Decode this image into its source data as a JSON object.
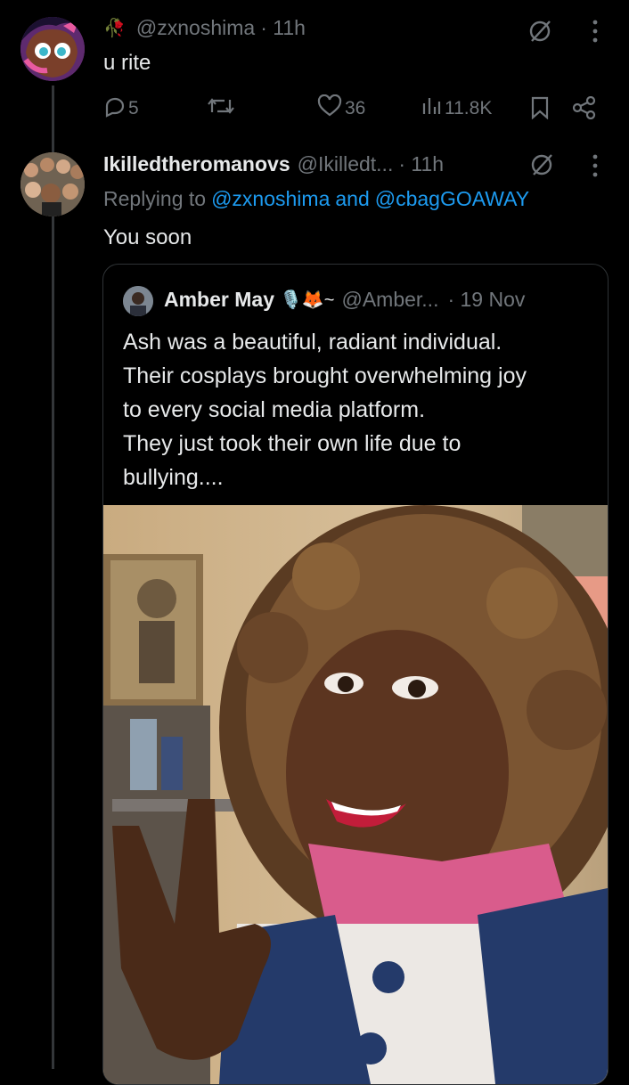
{
  "tweet1": {
    "rose_emoji": "🥀",
    "handle": "@zxnoshima",
    "time": "· 11h",
    "text": "u rite",
    "replies": "5",
    "likes": "36",
    "views": "11.8K"
  },
  "tweet2": {
    "display_name": "Ikilledtheromanovs",
    "handle": "@Ikilledt...",
    "time": "· 11h",
    "replying_prefix": "Replying to",
    "replying_user1": "@zxnoshima",
    "replying_and": "and",
    "replying_user2": "@cbagGOAWAY",
    "text": "You soon"
  },
  "quote": {
    "display_name": "Amber May",
    "emojis": "🎙️🦊~",
    "handle": "@Amber...",
    "date": "· 19 Nov",
    "lines": [
      "Ash was a beautiful, radiant individual.",
      "Their cosplays brought overwhelming joy",
      "to every social media platform.",
      "They just took their own life due to",
      "bullying...."
    ]
  },
  "colors": {
    "background": "#000000",
    "text": "#e7e9ea",
    "muted": "#71767b",
    "link": "#1d9bf0",
    "border": "#2f3336"
  },
  "icons": [
    "grok-icon",
    "more-icon",
    "reply-icon",
    "retweet-icon",
    "like-icon",
    "views-icon",
    "bookmark-icon",
    "share-icon"
  ]
}
